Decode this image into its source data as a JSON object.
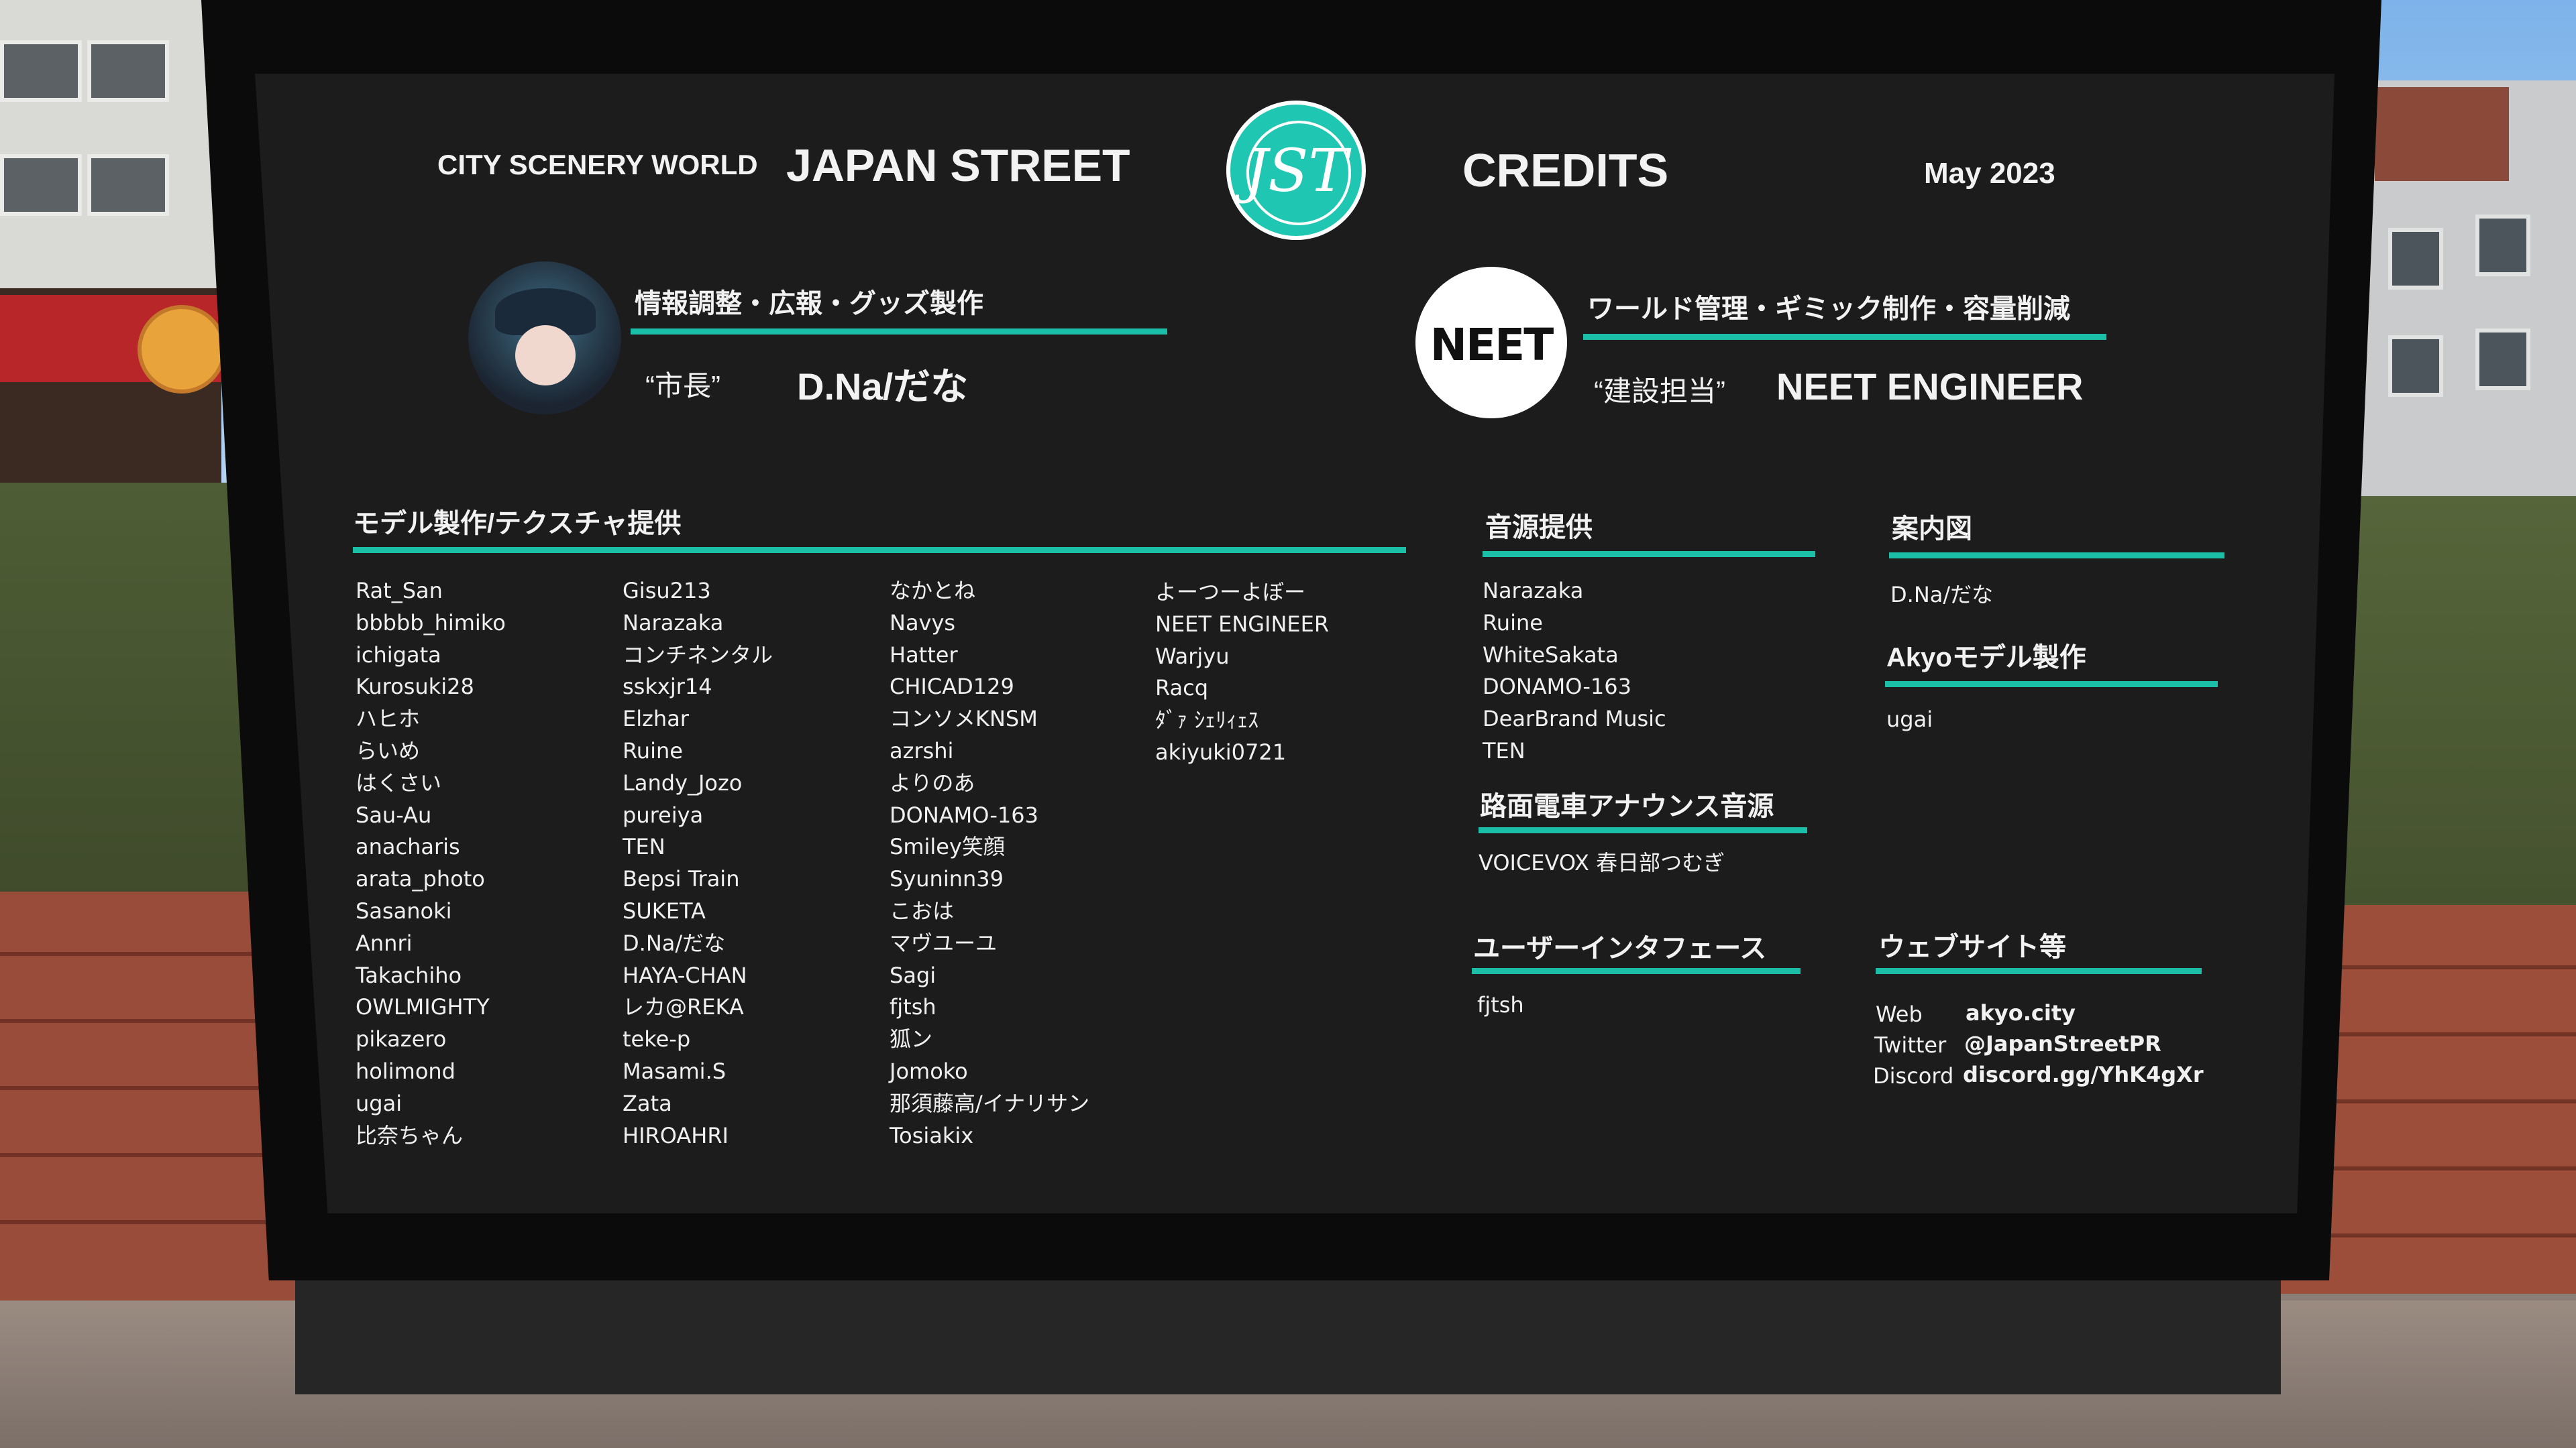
{
  "header": {
    "world": "CITY SCENERY WORLD",
    "street": "JAPAN STREET",
    "credits": "CREDITS",
    "date": "May 2023",
    "logo_text": "JST"
  },
  "lead1": {
    "role": "情報調整・広報・グッズ製作",
    "nickname": "“市長”",
    "name": "D.Na/だな"
  },
  "lead2": {
    "logo_text": "NEET",
    "role": "ワールド管理・ギミック制作・容量削減",
    "nickname": "“建設担当”",
    "name": "NEET ENGINEER"
  },
  "models": {
    "title": "モデル製作/テクスチャ提供",
    "col1": [
      "Rat_San",
      "bbbbb_himiko",
      "ichigata",
      "Kurosuki28",
      "ハヒホ",
      "らいめ",
      "はくさい",
      "Sau-Au",
      "anacharis",
      "arata_photo",
      "Sasanoki",
      "Annri",
      "Takachiho",
      "OWLMIGHTY",
      "pikazero",
      "holimond",
      "ugai",
      "比奈ちゃん"
    ],
    "col2": [
      "Gisu213",
      "Narazaka",
      "コンチネンタル",
      "sskxjr14",
      "Elzhar",
      "Ruine",
      "Landy_Jozo",
      "pureiya",
      "TEN",
      "Bepsi Train",
      "SUKETA",
      "D.Na/だな",
      "HAYA-CHAN",
      "レカ@REKA",
      "teke-p",
      "Masami.S",
      "Zata",
      "HIROAHRI"
    ],
    "col3": [
      "なかとね",
      "Navys",
      "Hatter",
      "CHICAD129",
      "コンソメKNSM",
      "azrshi",
      "よりのあ",
      "DONAMO-163",
      "Smiley笑顔",
      "Syuninn39",
      "こおは",
      "マヴユーユ",
      "Sagi",
      "fjtsh",
      "狐ン",
      "Jomoko",
      "那須藤高/イナリサン",
      "Tosiakix"
    ],
    "col4": [
      "よーつーよぼー",
      "NEET ENGINEER",
      "Warjyu",
      "Racq",
      "ﾀﾞｧ ｼｪﾘｨｪｽ",
      "akiyuki0721"
    ]
  },
  "sound": {
    "title": "音源提供",
    "items": [
      "Narazaka",
      "Ruine",
      "WhiteSakata",
      "DONAMO-163",
      "DearBrand Music",
      "TEN"
    ]
  },
  "tram": {
    "title": "路面電車アナウンス音源",
    "items": [
      "VOICEVOX 春日部つむぎ"
    ]
  },
  "ui": {
    "title": "ユーザーインタフェース",
    "items": [
      "fjtsh"
    ]
  },
  "map": {
    "title": "案内図",
    "items": [
      "D.Na/だな"
    ]
  },
  "akyo": {
    "title": "Akyoモデル製作",
    "items": [
      "ugai"
    ]
  },
  "web": {
    "title": "ウェブサイト等",
    "rows": [
      {
        "label": "Web",
        "value": "akyo.city"
      },
      {
        "label": "Twitter",
        "value": "@JapanStreetPR"
      },
      {
        "label": "Discord",
        "value": "discord.gg/YhK4gXr"
      }
    ]
  },
  "colors": {
    "accent": "#1bbfa8",
    "board": "#1c1c1c"
  }
}
